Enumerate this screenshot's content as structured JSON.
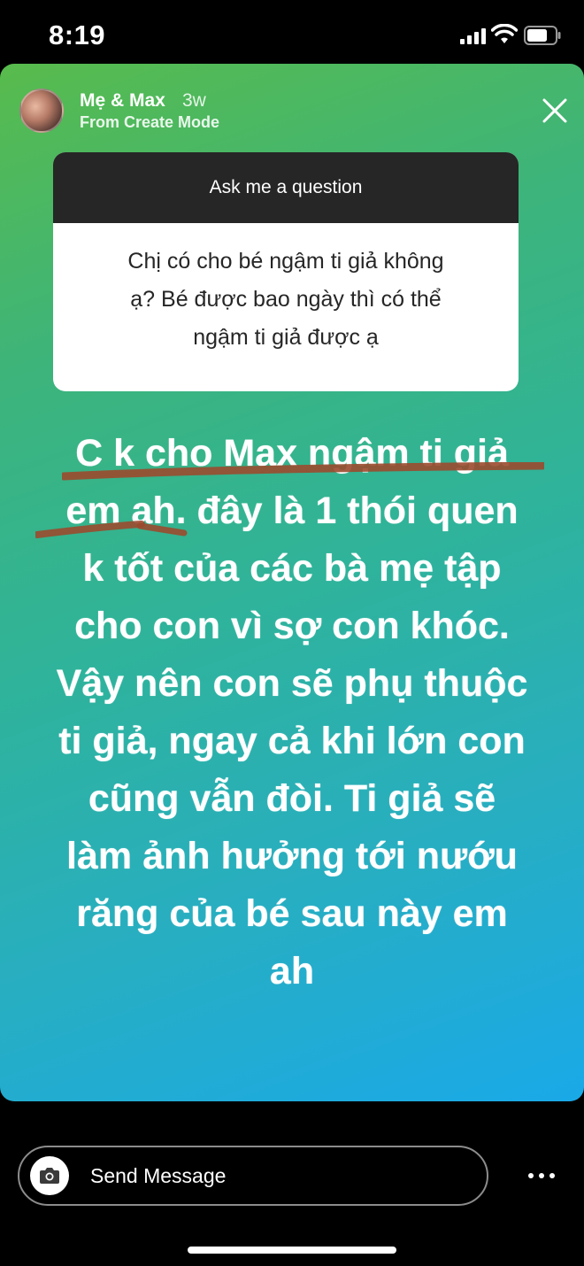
{
  "status_bar": {
    "time": "8:19"
  },
  "story": {
    "username": "Mẹ & Max",
    "time_ago": "3w",
    "subtitle": "From Create Mode",
    "gradient": [
      "#58bb4c",
      "#1aa9e8"
    ]
  },
  "question": {
    "header": "Ask me a question",
    "line1": "Chị có cho bé ngậm ti giả không",
    "line2": "ạ? Bé được bao ngày thì có thể",
    "line3": "ngậm ti giả được ạ"
  },
  "answer": {
    "lines": [
      "C k cho Max ngậm ti giả",
      "em ah. đây là 1 thói quen",
      "k tốt của các bà mẹ tập",
      "cho con vì sợ con khóc.",
      "Vậy nên con sẽ phụ thuộc",
      "ti giả, ngay cả khi lớn con",
      "cũng vẫn đòi. Ti giả sẽ",
      "làm ảnh hưởng tới nướu",
      "răng của bé sau này em",
      "ah"
    ],
    "underline_color": "#9b4a2e"
  },
  "reply": {
    "placeholder": "Send Message"
  }
}
